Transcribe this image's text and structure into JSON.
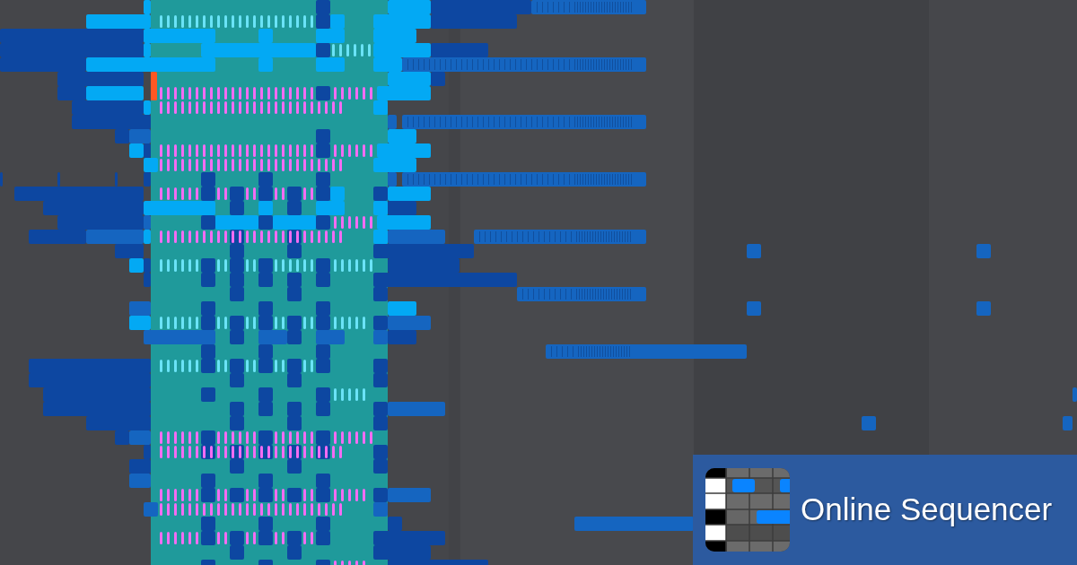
{
  "logo_badge": {
    "title": "Online Sequencer"
  }
}
